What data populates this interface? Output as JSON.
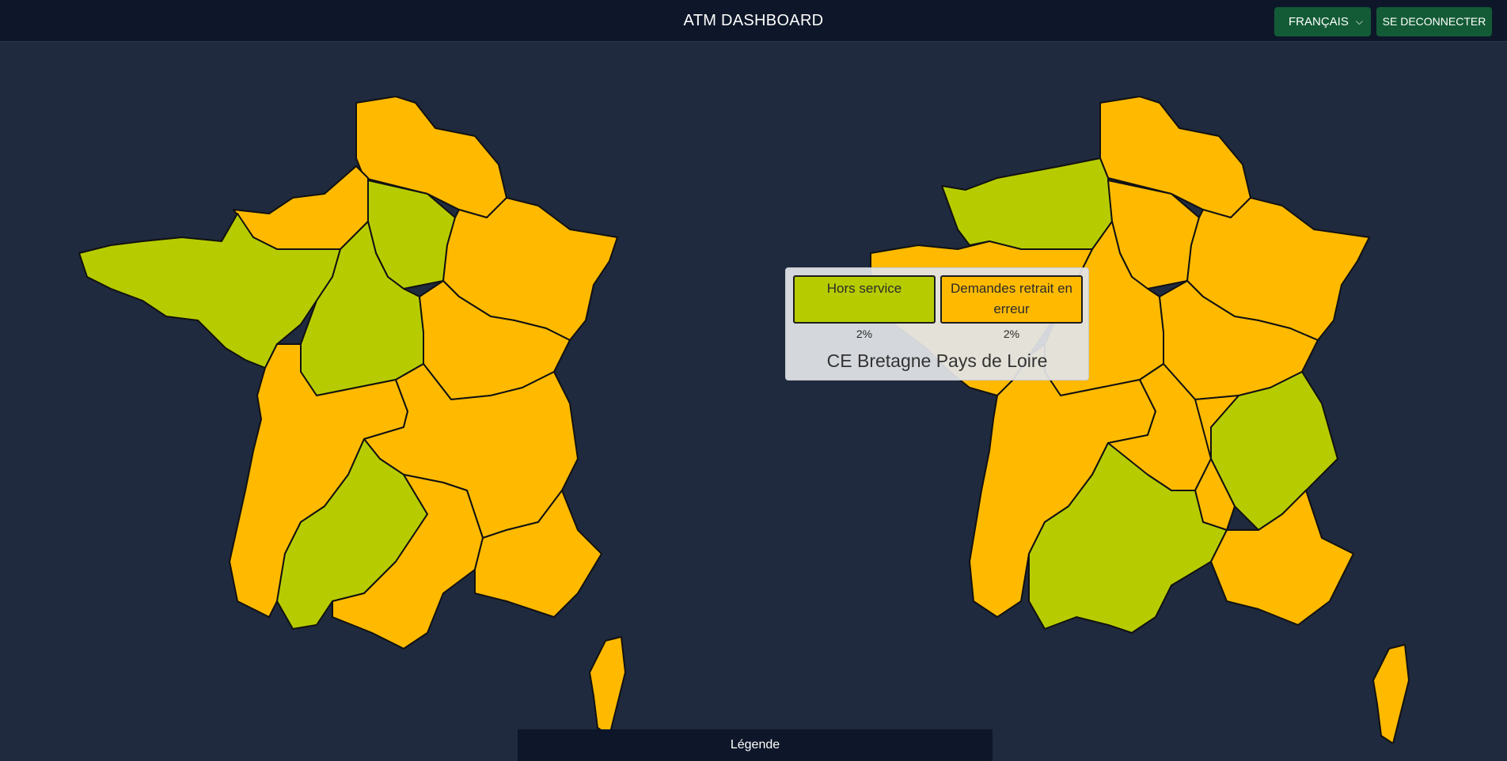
{
  "header": {
    "title": "ATM DASHBOARD",
    "language_selected": "FRANÇAIS",
    "logout_label": "SE DECONNECTER"
  },
  "tooltip": {
    "metrics": [
      {
        "label": "Hors service",
        "value": "2%",
        "color": "#b7cc00"
      },
      {
        "label": "Demandes retrait en erreur",
        "value": "2%",
        "color": "#ffba00"
      }
    ],
    "region": "CE Bretagne Pays de Loire"
  },
  "legend": {
    "label": "Légende"
  },
  "colors": {
    "ok_green": "#b7cc00",
    "warn_orange": "#ffba00",
    "background": "#1f2a3e",
    "topbar": "#0e1729",
    "button": "#135b36"
  }
}
